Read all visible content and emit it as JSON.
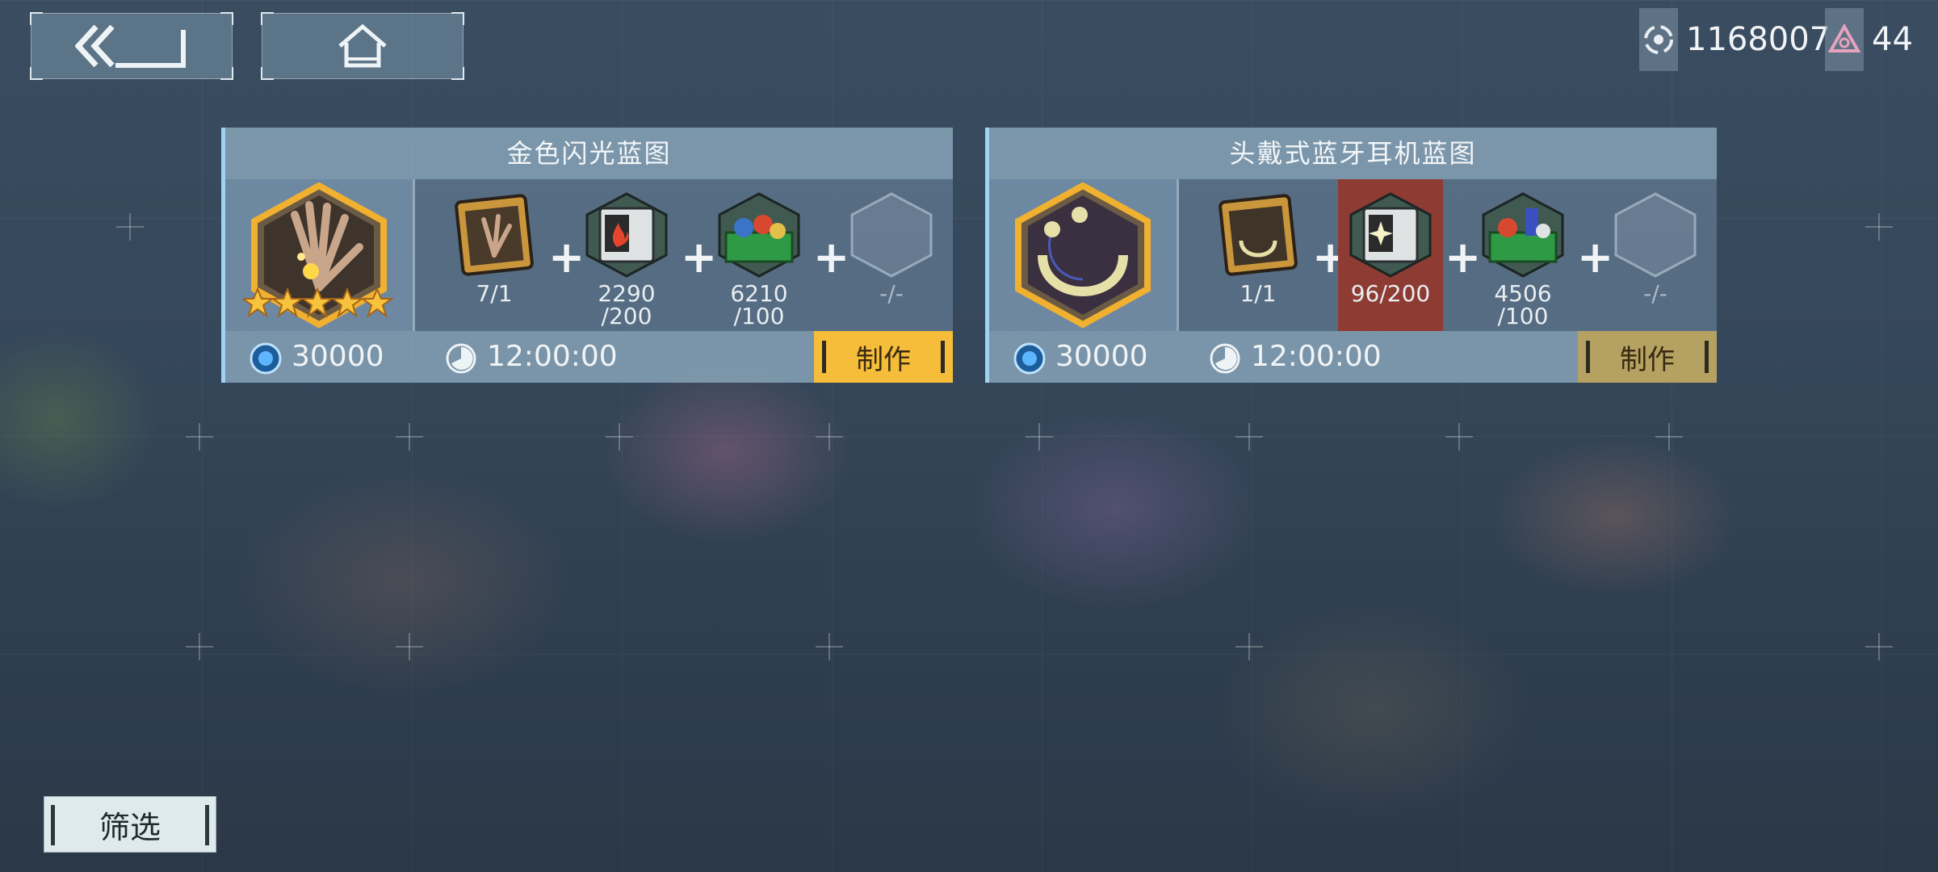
{
  "currencies": [
    {
      "icon": "eye-token-icon",
      "value": "1168007"
    },
    {
      "icon": "triangle-gem-icon",
      "value": "44"
    }
  ],
  "nav": {
    "back": "back-arrow-icon",
    "home": "home-icon"
  },
  "recipes": [
    {
      "title": "金色闪光蓝图",
      "product_icon": "golden-sparkle-hand-icon",
      "stars": 5,
      "materials": [
        {
          "icon": "blueprint-card-icon",
          "count": "7/1"
        },
        {
          "icon": "flame-data-chip-icon",
          "count": "2290\n/200"
        },
        {
          "icon": "green-parts-crate-icon",
          "count": "6210\n/100"
        },
        {
          "icon": "empty-slot-icon",
          "count": "-/-"
        }
      ],
      "cost": "30000",
      "time": "12:00:00",
      "craft_label": "制作",
      "craft_color": "#f5bd3a"
    },
    {
      "title": "头戴式蓝牙耳机蓝图",
      "product_icon": "neckband-headphones-icon",
      "stars": 0,
      "materials": [
        {
          "icon": "blueprint-card-icon",
          "count": "1/1"
        },
        {
          "icon": "sparkle-data-chip-icon",
          "count": "96/200",
          "insufficient": true
        },
        {
          "icon": "green-parts-crate-icon",
          "count": "4506\n/100"
        },
        {
          "icon": "empty-slot-icon",
          "count": "-/-"
        }
      ],
      "cost": "30000",
      "time": "12:00:00",
      "craft_label": "制作",
      "craft_color": "#b5a263"
    }
  ],
  "filter_label": "筛选"
}
